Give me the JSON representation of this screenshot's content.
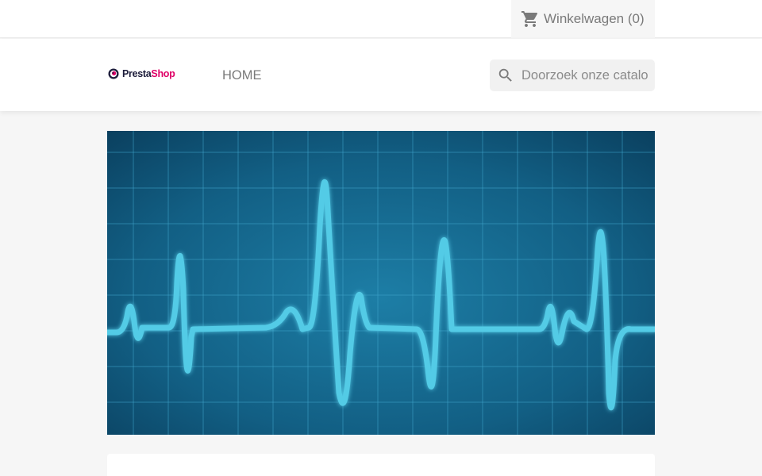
{
  "topbar": {
    "cart": {
      "icon": "shopping-cart-icon",
      "label": "Winkelwagen",
      "count": "(0)",
      "display": "Winkelwagen (0)"
    }
  },
  "header": {
    "logo": {
      "brand_first": "Presta",
      "brand_second": "Shop",
      "brand_color": "#df0067"
    },
    "nav": {
      "home_label": "HOME"
    },
    "search": {
      "placeholder": "Doorzoek onze catalogus",
      "icon": "search-icon"
    }
  },
  "banner": {
    "image": "heartbeat-ecg-monitor",
    "background_color": "#135f82",
    "line_color": "#53cbe6"
  },
  "colors": {
    "page_bg": "#f6f6f6",
    "text_muted": "#7a7a7a"
  }
}
